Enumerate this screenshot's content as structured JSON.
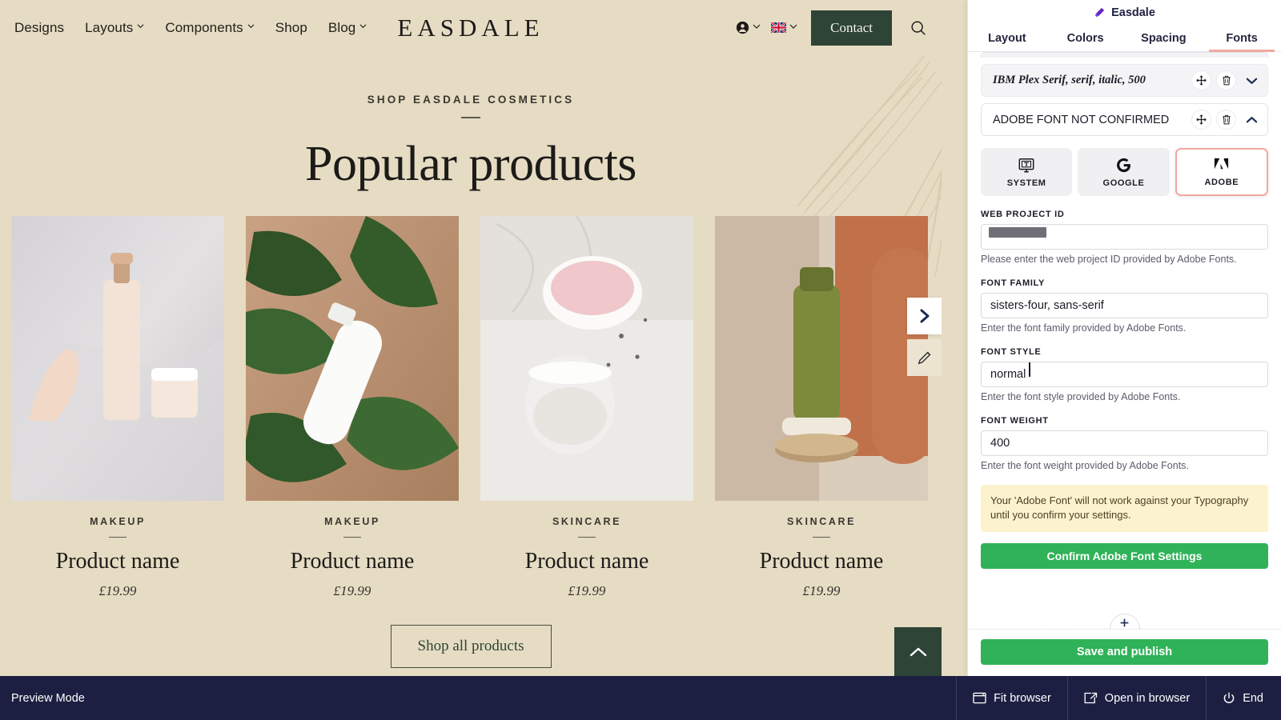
{
  "site": {
    "nav": [
      {
        "label": "Designs",
        "has_dropdown": false
      },
      {
        "label": "Layouts",
        "has_dropdown": true
      },
      {
        "label": "Components",
        "has_dropdown": true
      },
      {
        "label": "Shop",
        "has_dropdown": false
      },
      {
        "label": "Blog",
        "has_dropdown": true
      }
    ],
    "brand": "EASDALE",
    "account_icon": "person-icon",
    "language_icon": "uk-flag-icon",
    "contact_label": "Contact",
    "search_icon": "search-icon",
    "eyebrow": "SHOP EASDALE COSMETICS",
    "title": "Popular products",
    "products": [
      {
        "category": "MAKEUP",
        "name": "Product name",
        "price": "£19.99"
      },
      {
        "category": "MAKEUP",
        "name": "Product name",
        "price": "£19.99"
      },
      {
        "category": "SKINCARE",
        "name": "Product name",
        "price": "£19.99"
      },
      {
        "category": "SKINCARE",
        "name": "Product name",
        "price": "£19.99"
      }
    ],
    "shop_all_label": "Shop all products",
    "carousel_next_icon": "chevron-right-icon",
    "edit_icon": "pencil-icon",
    "scroll_top_icon": "chevron-up-icon",
    "colors": {
      "background": "#e6dcc3",
      "accent_green": "#2d4436",
      "text": "#1c1b18"
    }
  },
  "panel": {
    "title": "Easdale",
    "title_icon": "paintbrush-icon",
    "tabs": [
      {
        "label": "Layout",
        "active": false
      },
      {
        "label": "Colors",
        "active": false
      },
      {
        "label": "Spacing",
        "active": false
      },
      {
        "label": "Fonts",
        "active": true
      }
    ],
    "font_rows": [
      {
        "label": "IBM Plex Serif, serif, italic, 500",
        "style": "serif-italic",
        "move_icon": "move-icon",
        "delete_icon": "trash-icon",
        "chevron_icon": "chevron-down-icon"
      },
      {
        "label": "ADOBE FONT NOT CONFIRMED",
        "style": "plain",
        "move_icon": "move-icon",
        "delete_icon": "trash-icon",
        "chevron_icon": "chevron-up-icon"
      }
    ],
    "sources": [
      {
        "label": "SYSTEM",
        "icon": "monitor-text-icon",
        "selected": false
      },
      {
        "label": "GOOGLE",
        "icon": "google-g-icon",
        "selected": false
      },
      {
        "label": "ADOBE",
        "icon": "adobe-a-icon",
        "selected": true
      }
    ],
    "fields": [
      {
        "label": "WEB PROJECT ID",
        "value": "",
        "redacted": true,
        "help": "Please enter the web project ID provided by Adobe Fonts."
      },
      {
        "label": "FONT FAMILY",
        "value": "sisters-four, sans-serif",
        "redacted": false,
        "help": "Enter the font family provided by Adobe Fonts."
      },
      {
        "label": "FONT STYLE",
        "value": "normal",
        "redacted": false,
        "focused": true,
        "help": "Enter the font style provided by Adobe Fonts."
      },
      {
        "label": "FONT WEIGHT",
        "value": "400",
        "redacted": false,
        "help": "Enter the font weight provided by Adobe Fonts."
      }
    ],
    "warning": "Your 'Adobe Font' will not work against your Typography until you confirm your settings.",
    "confirm_label": "Confirm Adobe Font Settings",
    "add_font_icon": "add-icon",
    "save_publish_label": "Save and publish",
    "accent_color": "#f0a9a0",
    "button_green": "#30b358",
    "warning_bg": "#fcf2cd"
  },
  "bottombar": {
    "mode_label": "Preview Mode",
    "actions": [
      {
        "label": "Fit browser",
        "icon": "browser-window-icon"
      },
      {
        "label": "Open in browser",
        "icon": "external-link-icon"
      },
      {
        "label": "End",
        "icon": "power-icon"
      }
    ],
    "background": "#1d1f42"
  }
}
